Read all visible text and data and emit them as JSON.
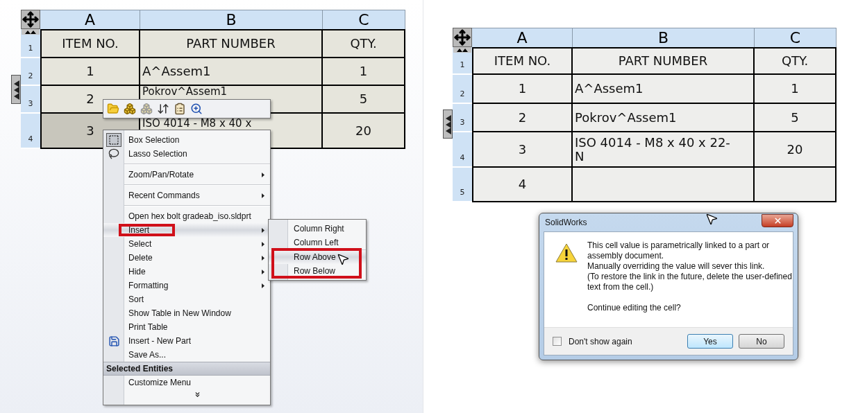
{
  "left_table": {
    "columns": [
      {
        "label": "A"
      },
      {
        "label": "B"
      },
      {
        "label": "C"
      }
    ],
    "rows": [
      {
        "number": "1",
        "kind": "header",
        "cells": [
          {
            "text": "ITEM NO.",
            "selected": false
          },
          {
            "text": "PART NUMBER",
            "selected": false
          },
          {
            "text": "QTY.",
            "selected": false
          }
        ]
      },
      {
        "number": "2",
        "kind": "data",
        "cells": [
          {
            "text": "1",
            "selected": false
          },
          {
            "text": "A^Assem1",
            "selected": false
          },
          {
            "text": "1",
            "selected": false
          }
        ]
      },
      {
        "number": "3",
        "kind": "data",
        "cells": [
          {
            "text": "2",
            "selected": false
          },
          {
            "text": "Pokrov^Assem1",
            "selected": false
          },
          {
            "text": "5",
            "selected": false
          }
        ]
      },
      {
        "number": "4",
        "kind": "data",
        "cells": [
          {
            "text": "3",
            "selected": true
          },
          {
            "text": "ISO 4014 - M8 x 40 x",
            "selected": false
          },
          {
            "text": "20",
            "selected": false
          }
        ]
      }
    ]
  },
  "context_menu": {
    "groups": [
      {
        "items": [
          {
            "label": "Box Selection",
            "submenu": false,
            "selected": false,
            "marked": false
          },
          {
            "label": "Lasso Selection",
            "submenu": false,
            "selected": false,
            "marked": false
          }
        ]
      },
      {
        "items": [
          {
            "label": "Zoom/Pan/Rotate",
            "submenu": true,
            "selected": false,
            "marked": false
          }
        ]
      },
      {
        "items": [
          {
            "label": "Recent Commands",
            "submenu": true,
            "selected": false,
            "marked": false
          }
        ]
      },
      {
        "items": [
          {
            "label": "Open hex bolt gradeab_iso.sldprt",
            "submenu": false,
            "selected": false,
            "marked": false
          },
          {
            "label": "Insert",
            "submenu": true,
            "selected": true,
            "marked": true
          },
          {
            "label": "Select",
            "submenu": true,
            "selected": false,
            "marked": false
          },
          {
            "label": "Delete",
            "submenu": true,
            "selected": false,
            "marked": false
          },
          {
            "label": "Hide",
            "submenu": true,
            "selected": false,
            "marked": false
          },
          {
            "label": "Formatting",
            "submenu": true,
            "selected": false,
            "marked": false
          },
          {
            "label": "Sort",
            "submenu": false,
            "selected": false,
            "marked": false
          },
          {
            "label": "Show Table in New Window",
            "submenu": false,
            "selected": false,
            "marked": false
          },
          {
            "label": "Print Table",
            "submenu": false,
            "selected": false,
            "marked": false
          },
          {
            "label": "Insert - New Part",
            "submenu": false,
            "selected": false,
            "marked": false
          },
          {
            "label": "Save As...",
            "submenu": false,
            "selected": false,
            "marked": false
          }
        ]
      }
    ],
    "section": {
      "title": "Selected Entities",
      "items": [
        {
          "label": "Customize Menu",
          "submenu": false,
          "selected": false,
          "marked": false
        }
      ]
    }
  },
  "submenu": {
    "groups": [
      {
        "marked": false,
        "items": [
          {
            "label": "Column Right",
            "selected": false
          },
          {
            "label": "Column Left",
            "selected": false
          }
        ]
      },
      {
        "marked": true,
        "items": [
          {
            "label": "Row Above",
            "selected": true
          },
          {
            "label": "Row Below",
            "selected": false
          }
        ]
      }
    ]
  },
  "right_table": {
    "columns": [
      {
        "label": "A"
      },
      {
        "label": "B"
      },
      {
        "label": "C"
      }
    ],
    "rows": [
      {
        "number": "1",
        "kind": "header",
        "cells": [
          {
            "text": "ITEM NO."
          },
          {
            "text": "PART NUMBER"
          },
          {
            "text": "QTY."
          }
        ]
      },
      {
        "number": "2",
        "kind": "data",
        "cells": [
          {
            "text": "1"
          },
          {
            "text": "A^Assem1"
          },
          {
            "text": "1"
          }
        ]
      },
      {
        "number": "3",
        "kind": "data",
        "cells": [
          {
            "text": "2"
          },
          {
            "text": "Pokrov^Assem1"
          },
          {
            "text": "5"
          }
        ]
      },
      {
        "number": "4",
        "kind": "data",
        "cells": [
          {
            "text": "3"
          },
          {
            "text": "ISO 4014 - M8 x 40 x 22-N"
          },
          {
            "text": "20"
          }
        ]
      },
      {
        "number": "5",
        "kind": "data",
        "cells": [
          {
            "text": "4"
          },
          {},
          {}
        ]
      }
    ]
  },
  "dialog": {
    "title": "SolidWorks",
    "message": [
      "This cell value is parametrically linked to a part or assembly document.",
      "Manually overriding the value will sever this link.",
      "(To restore the link in the future, delete the user-defined text from the cell.)"
    ],
    "question": "Continue editing the cell?",
    "checkbox": {
      "label": "Don't show again",
      "checked": false
    },
    "buttons": [
      {
        "label": "Yes",
        "default": true
      },
      {
        "label": "No",
        "default": false
      }
    ]
  }
}
